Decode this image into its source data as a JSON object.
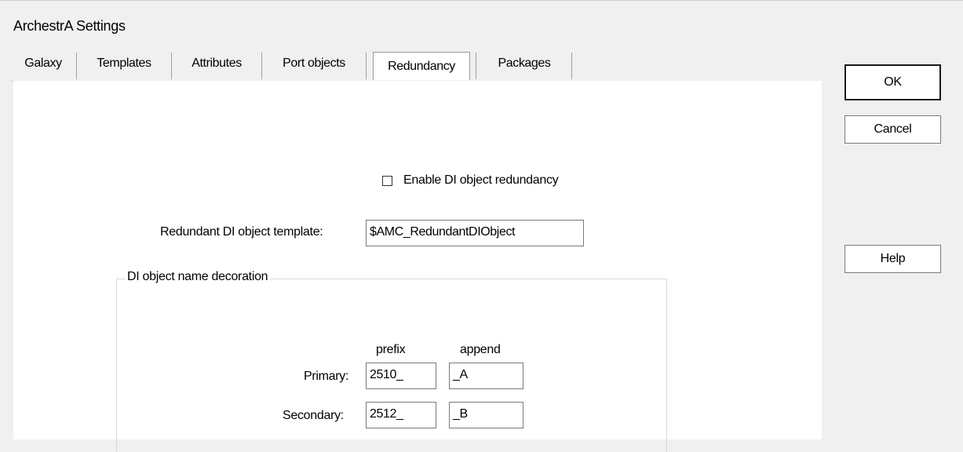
{
  "window": {
    "title": "ArchestrA Settings"
  },
  "tabs": [
    {
      "label": "Galaxy"
    },
    {
      "label": "Templates"
    },
    {
      "label": "Attributes"
    },
    {
      "label": "Port objects"
    },
    {
      "label": "Redundancy",
      "active": true
    },
    {
      "label": "Packages"
    }
  ],
  "redundancy": {
    "enable_label": "Enable DI object redundancy",
    "enable_checked": false,
    "template_label": "Redundant DI object template:",
    "template_value": "$AMC_RedundantDIObject",
    "group_title": "DI object name decoration",
    "col_prefix": "prefix",
    "col_append": "append",
    "primary_label": "Primary:",
    "primary_prefix": "2510_",
    "primary_append": "_A",
    "secondary_label": "Secondary:",
    "secondary_prefix": "2512_",
    "secondary_append": "_B"
  },
  "buttons": {
    "ok": "OK",
    "cancel": "Cancel",
    "help": "Help"
  }
}
